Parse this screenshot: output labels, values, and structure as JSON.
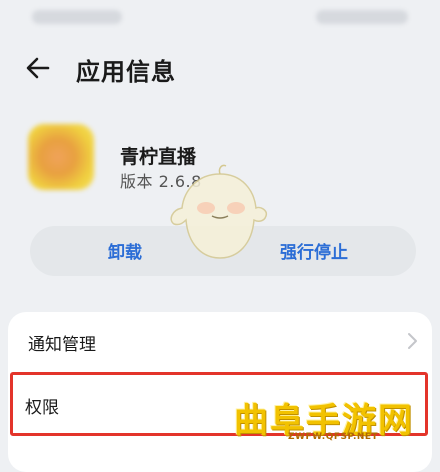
{
  "header": {
    "title": "应用信息"
  },
  "app": {
    "name": "青柠直播",
    "version": "版本 2.6.8"
  },
  "actions": {
    "uninstall": "卸载",
    "force_stop": "强行停止"
  },
  "settings": [
    {
      "label": "通知管理"
    },
    {
      "label": "权限"
    }
  ],
  "watermark": {
    "title": "曲阜手游网",
    "url": "ZWFW.QFSP.NET"
  },
  "colors": {
    "accent": "#2b6dd6",
    "highlight": "#e3342a",
    "watermark": "#f2c200"
  }
}
